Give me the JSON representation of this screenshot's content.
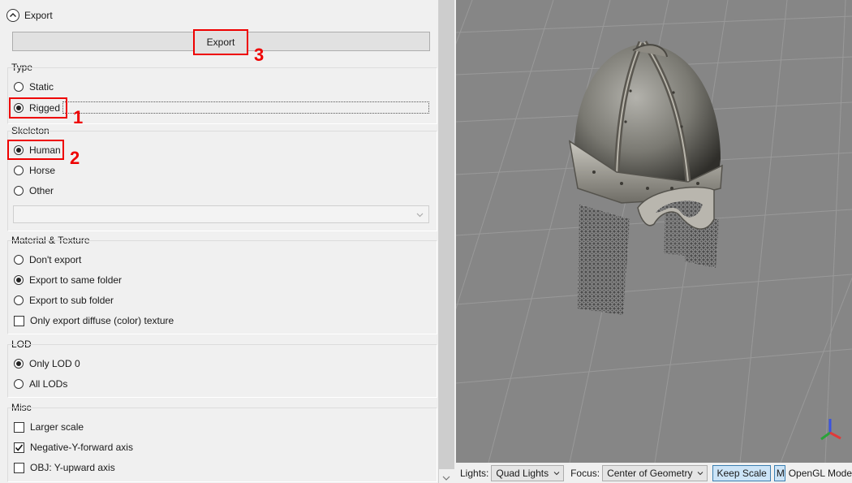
{
  "export_section": {
    "title": "Export",
    "icon": "chevron-up-icon",
    "export_button_label": "Export"
  },
  "annotations": [
    "1",
    "2",
    "3"
  ],
  "type_group": {
    "label": "Type",
    "options": [
      {
        "label": "Static",
        "selected": false
      },
      {
        "label": "Rigged",
        "selected": true
      }
    ]
  },
  "skeleton_group": {
    "label": "Skeleton",
    "options": [
      {
        "label": "Human",
        "selected": true
      },
      {
        "label": "Horse",
        "selected": false
      },
      {
        "label": "Other",
        "selected": false
      }
    ],
    "combo_value": ""
  },
  "material_group": {
    "label": "Material & Texture",
    "options": [
      {
        "label": "Don't export",
        "selected": false
      },
      {
        "label": "Export to same folder",
        "selected": true
      },
      {
        "label": "Export to sub folder",
        "selected": false
      }
    ],
    "checkbox": {
      "label": "Only export diffuse (color) texture",
      "checked": false
    }
  },
  "lod_group": {
    "label": "LOD",
    "options": [
      {
        "label": "Only LOD 0",
        "selected": true
      },
      {
        "label": "All LODs",
        "selected": false
      }
    ]
  },
  "misc_group": {
    "label": "Misc",
    "checkboxes": [
      {
        "label": "Larger scale",
        "checked": false
      },
      {
        "label": "Negative-Y-forward axis",
        "checked": true
      },
      {
        "label": "OBJ: Y-upward axis",
        "checked": false
      }
    ]
  },
  "toolbar": {
    "lights_label": "Lights:",
    "lights_value": "Quad Lights",
    "focus_label": "Focus:",
    "focus_value": "Center of Geometry",
    "keep_scale_label": "Keep Scale",
    "cut_button_label": "Mi",
    "mode_label": "OpenGL Mode"
  },
  "colors": {
    "highlight": "#ee0000",
    "viewport_background": "#8a8a8a",
    "toggle_active": "#cce4f7"
  }
}
